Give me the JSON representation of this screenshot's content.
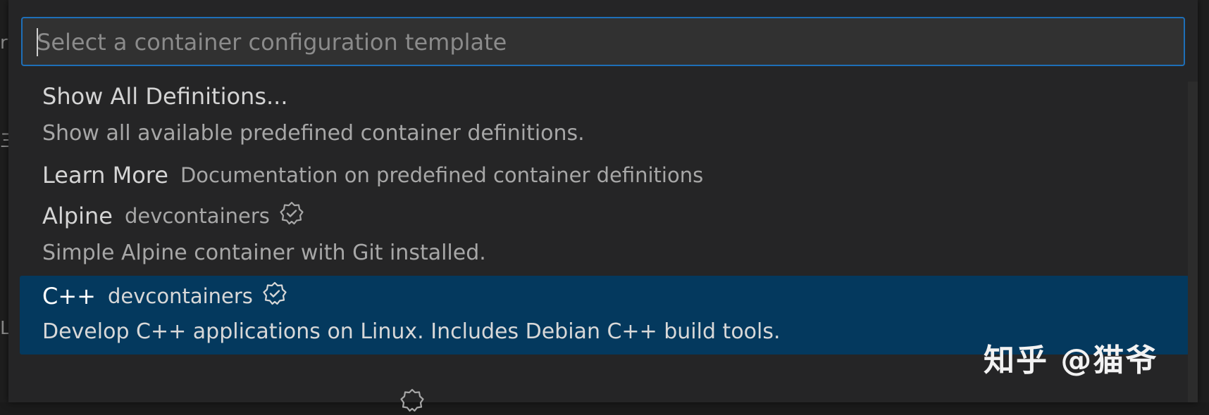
{
  "editor": {
    "edge_glyphs": [
      "rv",
      "三",
      "Lo"
    ]
  },
  "picker": {
    "placeholder": "Select a container configuration template",
    "value": "",
    "items": [
      {
        "label": "Show All Definitions...",
        "detail": "",
        "description": "Show all available predefined container definitions.",
        "verified": false,
        "selected": false
      },
      {
        "label": "Learn More",
        "detail": "Documentation on predefined container definitions",
        "description": "",
        "verified": false,
        "selected": false
      },
      {
        "label": "Alpine",
        "detail": "devcontainers",
        "description": "Simple Alpine container with Git installed.",
        "verified": true,
        "selected": false
      },
      {
        "label": "C++",
        "detail": "devcontainers",
        "description": "Develop C++ applications on Linux. Includes Debian C++ build tools.",
        "verified": true,
        "selected": true
      }
    ]
  },
  "watermark": {
    "text": "知乎 @猫爷"
  },
  "colors": {
    "accent_border": "#1e6fb8",
    "selection_bg": "#04395e",
    "panel_bg": "#252526",
    "input_bg": "#313131"
  },
  "icons": {
    "verified": "verified-badge-icon"
  }
}
